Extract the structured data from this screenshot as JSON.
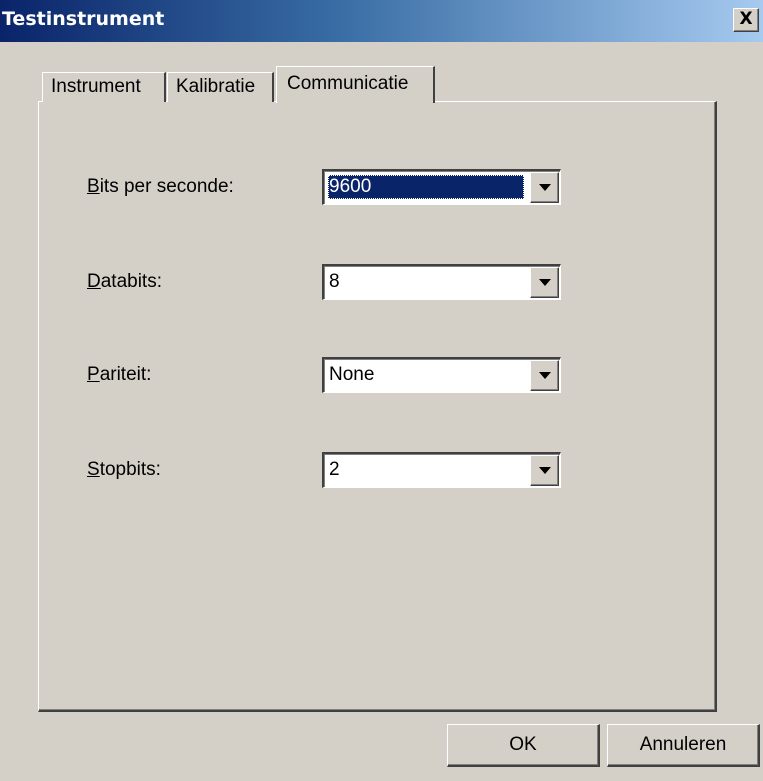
{
  "window": {
    "title": "Testinstrument",
    "close_symbol": "X"
  },
  "tabs": [
    {
      "label": "Instrument",
      "active": false
    },
    {
      "label": "Kalibratie",
      "active": false
    },
    {
      "label": "Communicatie",
      "active": true
    }
  ],
  "fields": [
    {
      "label_mnemonic": "B",
      "label_rest": "its per seconde:",
      "value": "9600",
      "selected": true
    },
    {
      "label_mnemonic": "D",
      "label_rest": "atabits:",
      "value": "8",
      "selected": false
    },
    {
      "label_mnemonic": "P",
      "label_rest": "ariteit:",
      "value": "None",
      "selected": false
    },
    {
      "label_mnemonic": "S",
      "label_rest": "topbits:",
      "value": "2",
      "selected": false
    }
  ],
  "buttons": {
    "ok": "OK",
    "cancel": "Annuleren"
  },
  "colors": {
    "title_active": "#0a246a",
    "face": "#d4d0c8",
    "selection": "#0a246a"
  }
}
